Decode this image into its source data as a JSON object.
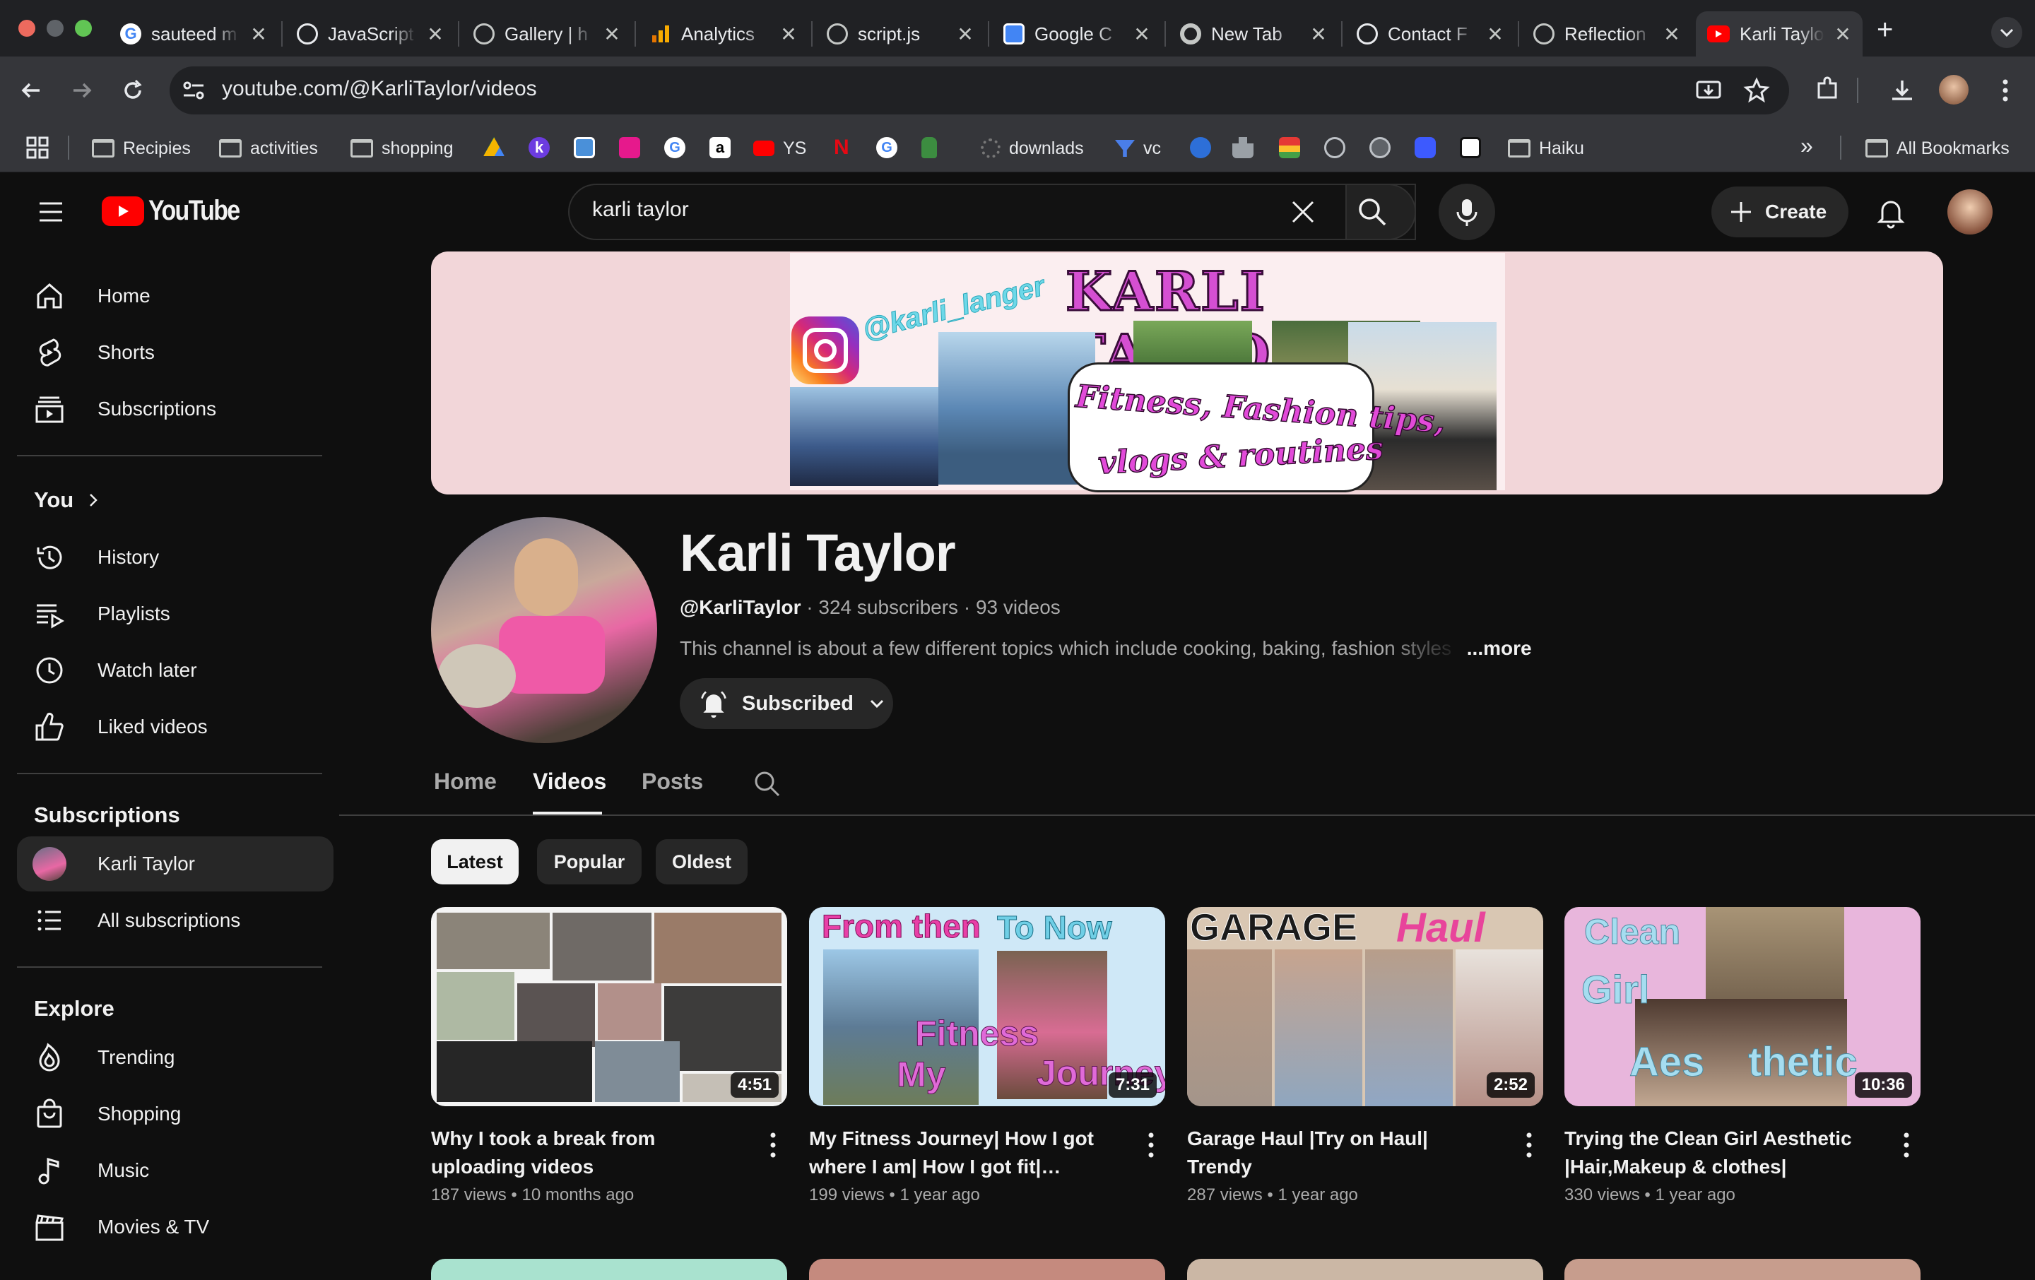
{
  "browser": {
    "tabs": [
      {
        "title": "sauteed m",
        "fav": "google-icon"
      },
      {
        "title": "JavaScript",
        "fav": "openai-icon"
      },
      {
        "title": "Gallery | h",
        "fav": "globe-icon"
      },
      {
        "title": "Analytics",
        "fav": "analytics-icon"
      },
      {
        "title": "script.js",
        "fav": "globe-icon"
      },
      {
        "title": "Google C",
        "fav": "google-cloud-icon"
      },
      {
        "title": "New Tab",
        "fav": "chrome-icon"
      },
      {
        "title": "Contact F",
        "fav": "openai-icon"
      },
      {
        "title": "Reflection",
        "fav": "globe-icon"
      },
      {
        "title": "Karli Taylo",
        "fav": "youtube-icon"
      }
    ],
    "url": "youtube.com/@KarliTaylor/videos",
    "bookmarks": {
      "recipies": "Recipies",
      "activities": "activities",
      "shopping": "shopping",
      "ys": "YS",
      "downlads": "downlads",
      "vc": "vc",
      "haiku": "Haiku",
      "all": "All Bookmarks"
    }
  },
  "youtube": {
    "logo": "YouTube",
    "search_value": "karli taylor",
    "create_label": "Create"
  },
  "sidebar": {
    "main": [
      {
        "label": "Home",
        "icon": "home-icon"
      },
      {
        "label": "Shorts",
        "icon": "shorts-icon"
      },
      {
        "label": "Subscriptions",
        "icon": "subscriptions-icon"
      }
    ],
    "you_heading": "You",
    "you": [
      {
        "label": "History",
        "icon": "history-icon"
      },
      {
        "label": "Playlists",
        "icon": "playlists-icon"
      },
      {
        "label": "Watch later",
        "icon": "watch-later-icon"
      },
      {
        "label": "Liked videos",
        "icon": "like-icon"
      }
    ],
    "subs_heading": "Subscriptions",
    "subs": [
      {
        "label": "Karli Taylor",
        "icon": "channel-avatar"
      },
      {
        "label": "All subscriptions",
        "icon": "list-icon"
      }
    ],
    "explore_heading": "Explore",
    "explore": [
      {
        "label": "Trending",
        "icon": "trending-icon"
      },
      {
        "label": "Shopping",
        "icon": "shopping-bag-icon"
      },
      {
        "label": "Music",
        "icon": "music-icon"
      },
      {
        "label": "Movies & TV",
        "icon": "movies-icon"
      }
    ]
  },
  "banner": {
    "handle": "@karli_langer",
    "name": "KARLI TAYLOR",
    "tagline_1": "Fitness, Fashion tips,",
    "tagline_2": "vlogs & routines"
  },
  "channel": {
    "name": "Karli Taylor",
    "handle": "@KarliTaylor",
    "subscribers": "324 subscribers",
    "videos": "93 videos",
    "separator": "·",
    "description": "This channel is about a few different topics which include cooking, baking, fashion styles",
    "more": "...more",
    "subscribed_label": "Subscribed"
  },
  "channel_tabs": [
    "Home",
    "Videos",
    "Posts"
  ],
  "active_tab": "Videos",
  "chips": [
    "Latest",
    "Popular",
    "Oldest"
  ],
  "selected_chip": "Latest",
  "videos": [
    {
      "title": "Why I took a break from uploading videos",
      "views": "187 views",
      "age": "10 months ago",
      "duration": "4:51"
    },
    {
      "title": "My Fitness Journey| How I got where I am| How I got fit| Different…",
      "views": "199 views",
      "age": "1 year ago",
      "duration": "7:31",
      "thumb_text": {
        "a": "From then",
        "b": "To Now",
        "c": "Fitness",
        "d": "My",
        "e": "Journey"
      }
    },
    {
      "title": "Garage Haul |Try on Haul| Trendy",
      "views": "287 views",
      "age": "1 year ago",
      "duration": "2:52",
      "thumb_text": {
        "a": "GARAGE",
        "b": "Haul"
      }
    },
    {
      "title": "Trying the Clean Girl Aesthetic |Hair,Makeup & clothes|",
      "views": "330 views",
      "age": "1 year ago",
      "duration": "10:36",
      "thumb_text": {
        "a": "Clean",
        "b": "Girl",
        "c": "Aes",
        "d": "thetic"
      }
    }
  ],
  "dot": "•",
  "colors": {
    "brand_red": "#ff0000",
    "bg": "#0f0f0f",
    "banner_bg": "#f2d6d9"
  }
}
